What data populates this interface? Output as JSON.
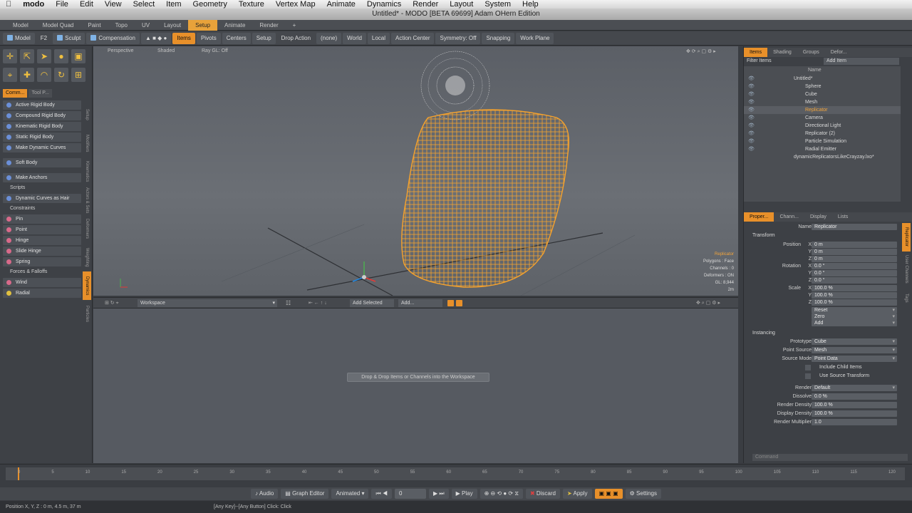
{
  "menubar": {
    "app": "modo",
    "items": [
      "File",
      "Edit",
      "View",
      "Select",
      "Item",
      "Geometry",
      "Texture",
      "Vertex Map",
      "Animate",
      "Dynamics",
      "Render",
      "Layout",
      "System",
      "Help"
    ]
  },
  "window_title": "Untitled* - MODO [BETA 69699] Adam OHern Edition",
  "layout_tabs": [
    "Model",
    "Model Quad",
    "Paint",
    "Topo",
    "UV",
    "Layout",
    "Setup",
    "Animate",
    "Render",
    "+"
  ],
  "active_layout_tab": "Setup",
  "toolbar": {
    "model": "Model",
    "f2": "F2",
    "sculpt": "Sculpt",
    "compensation": "Compensation",
    "items": "Items",
    "pivots": "Pivots",
    "centers": "Centers",
    "setup": "Setup",
    "drop_action_label": "Drop Action",
    "drop_action_value": "(none)",
    "world": "World",
    "local": "Local",
    "action_center": "Action Center",
    "symmetry": "Symmetry: Off",
    "snapping": "Snapping",
    "work_plane": "Work Plane"
  },
  "left_panel": {
    "tabs": [
      "Comm...",
      "Tool P..."
    ],
    "rigid_buttons": [
      "Active Rigid Body",
      "Compound Rigid Body",
      "Kinematic Rigid Body",
      "Static Rigid Body",
      "Make Dynamic Curves"
    ],
    "soft_body": "Soft Body",
    "make_anchors": "Make Anchors",
    "scripts_header": "Scripts",
    "dynamic_curves_hair": "Dynamic Curves as Hair",
    "constraints_header": "Constraints",
    "constraints": [
      "Pin",
      "Point",
      "Hinge",
      "Slide Hinge",
      "Spring"
    ],
    "forces_header": "Forces & Falloffs",
    "forces": [
      "Wind",
      "Radial"
    ],
    "vertical_tabs": [
      "Setup",
      "Modifiers",
      "Inverse Kinematics",
      "Actors & Sets",
      "Deformers",
      "Weighting",
      "Dynamics",
      "Particles"
    ]
  },
  "viewport": {
    "perspective": "Perspective",
    "shaded": "Shaded",
    "raygl": "Ray GL: Off",
    "info": [
      "Replicator",
      "Polygons : Face",
      "Channels : 0",
      "Deformers : ON",
      "GL: 8,944",
      "2m"
    ]
  },
  "workspace": {
    "dropdown": "Workspace",
    "add_selected": "Add Selected",
    "add": "Add...",
    "drop_message": "Drop & Drop Items or Channels into the Workspace"
  },
  "items_panel": {
    "tabs": [
      "Items",
      "Shading",
      "Groups",
      "Defor..."
    ],
    "filter_label": "Filter Items",
    "add_item": "Add Item",
    "name_header": "Name",
    "tree": [
      {
        "name": "Untitled*",
        "indent": 0,
        "state": ""
      },
      {
        "name": "Sphere",
        "indent": 1,
        "state": ""
      },
      {
        "name": "Cube",
        "indent": 1,
        "state": ""
      },
      {
        "name": "Mesh",
        "indent": 1,
        "state": ""
      },
      {
        "name": "Replicator",
        "indent": 1,
        "state": "selected"
      },
      {
        "name": "Camera",
        "indent": 1,
        "state": ""
      },
      {
        "name": "Directional Light",
        "indent": 1,
        "state": ""
      },
      {
        "name": "Replicator (2)",
        "indent": 1,
        "state": ""
      },
      {
        "name": "Particle Simulation",
        "indent": 1,
        "state": ""
      },
      {
        "name": "Radial Emitter",
        "indent": 1,
        "state": ""
      },
      {
        "name": "dynamicReplicatorsLikeCrayzay.lxo*",
        "indent": 0,
        "state": ""
      }
    ]
  },
  "properties_panel": {
    "tabs": [
      "Proper...",
      "Chann...",
      "Display",
      "Lists"
    ],
    "name_label": "Name",
    "name_value": "Replicator",
    "transform_header": "Transform",
    "position_label": "Position",
    "position": [
      "0 m",
      "0 m",
      "0 m"
    ],
    "rotation_label": "Rotation",
    "rotation": [
      "0.0 °",
      "0.0 °",
      "0.0 °"
    ],
    "scale_label": "Scale",
    "scale": [
      "100.0 %",
      "100.0 %",
      "100.0 %"
    ],
    "axes": [
      "X",
      "Y",
      "Z"
    ],
    "reset": "Reset",
    "zero": "Zero",
    "add": "Add",
    "instancing_header": "Instancing",
    "prototype_label": "Prototype",
    "prototype_value": "Cube",
    "point_source_label": "Point Source",
    "point_source_value": "Mesh",
    "source_mode_label": "Source Mode",
    "source_mode_value": "Point Data",
    "include_child": "Include Child Items",
    "use_source_transform": "Use Source Transform",
    "render_label": "Render",
    "render_value": "Default",
    "dissolve_label": "Dissolve",
    "dissolve_value": "0.0 %",
    "render_density_label": "Render Density",
    "render_density_value": "100.0 %",
    "display_density_label": "Display Density",
    "display_density_value": "100.0 %",
    "render_multiplier_label": "Render Multiplier",
    "render_multiplier_value": "1.0",
    "side_tabs": [
      "Replicator",
      "User Channels",
      "Tags"
    ],
    "command_placeholder": "Command"
  },
  "timeline": {
    "ticks": [
      "0",
      "5",
      "10",
      "15",
      "20",
      "25",
      "30",
      "35",
      "40",
      "45",
      "50",
      "55",
      "60",
      "65",
      "70",
      "75",
      "80",
      "85",
      "90",
      "95",
      "100",
      "105",
      "110",
      "115",
      "120"
    ],
    "end": "120"
  },
  "bottom_bar": {
    "audio": "Audio",
    "graph_editor": "Graph Editor",
    "animated": "Animated",
    "frame": "0",
    "play": "Play",
    "discard": "Discard",
    "apply": "Apply",
    "settings": "Settings"
  },
  "status": {
    "left": "Position X, Y, Z :  0 m, 4.5 m, 37 m",
    "center": "[Any Key]--[Any Button] Click: Click"
  },
  "colors": {
    "accent": "#e8902a",
    "wire": "#f5a22d"
  }
}
